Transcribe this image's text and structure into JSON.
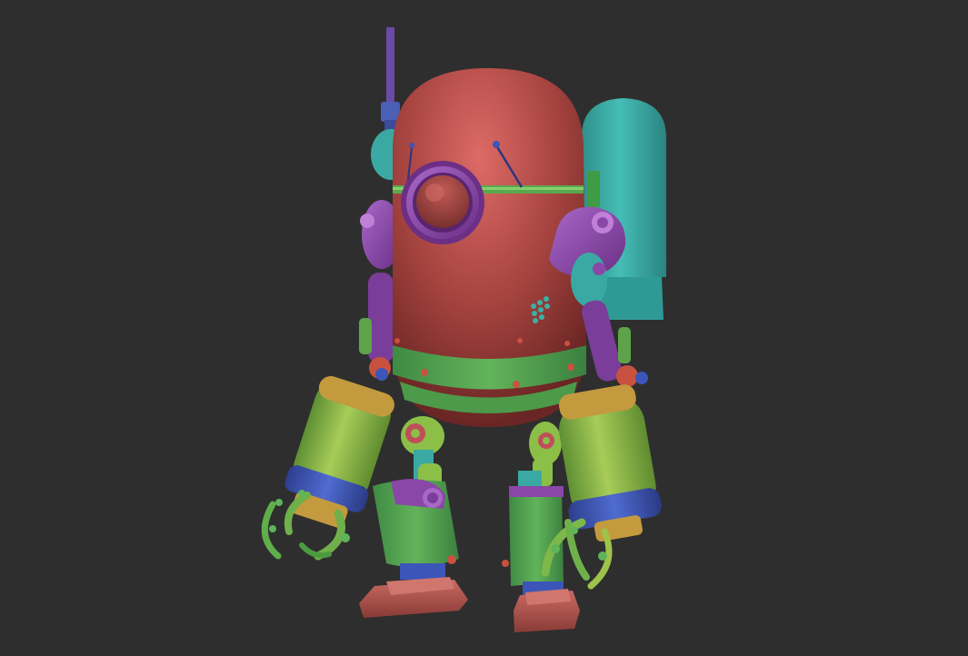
{
  "scene": {
    "subject": "robot",
    "colors": {
      "background": "#2e2e2e",
      "body_red": "#b24c4a",
      "purple": "#8a47a8",
      "teal": "#35a8a3",
      "green": "#6fb04a",
      "yellow_green": "#9fc24a",
      "blue": "#3c55b8",
      "ochre": "#c49a3e"
    }
  }
}
